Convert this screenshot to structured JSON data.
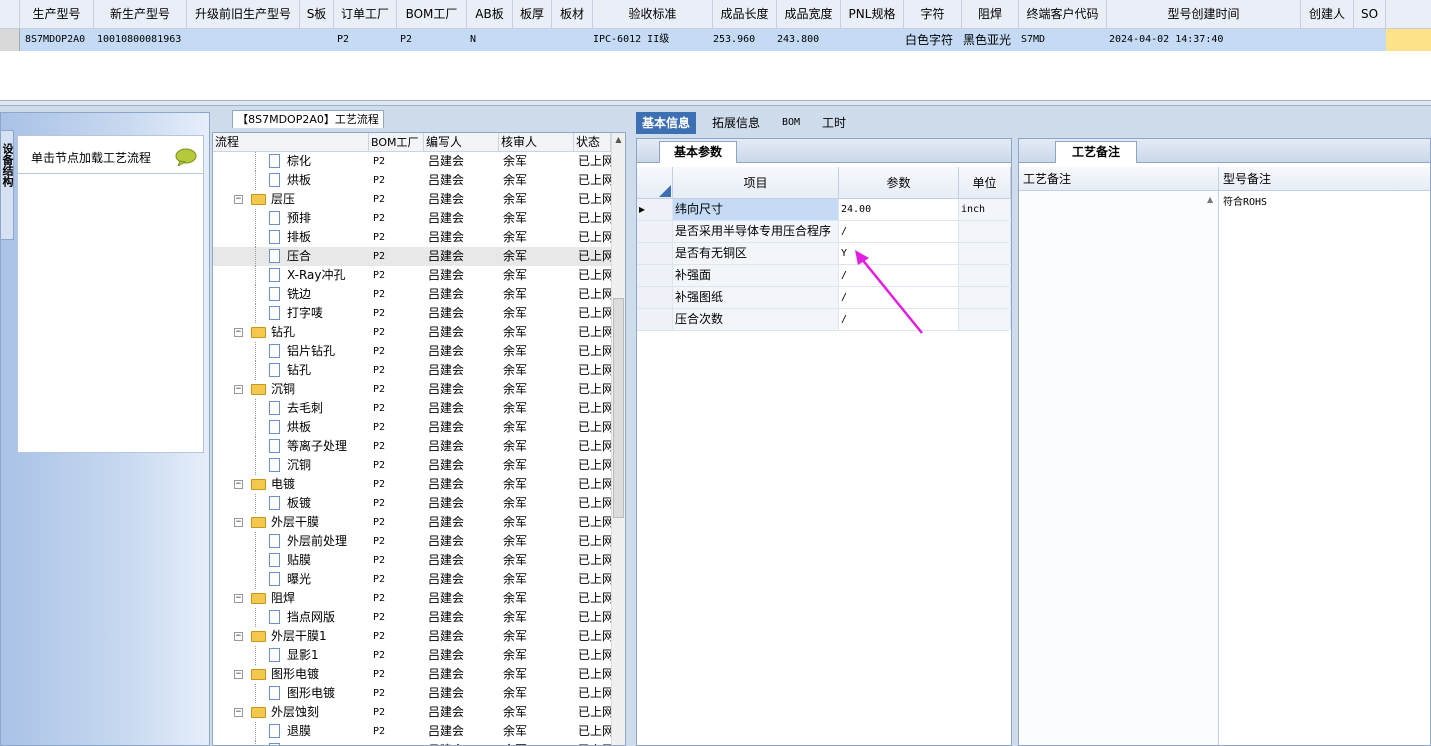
{
  "top_grid": {
    "headers": [
      "生产型号",
      "新生产型号",
      "升级前旧生产型号",
      "S板",
      "订单工厂",
      "BOM工厂",
      "AB板",
      "板厚",
      "板材",
      "验收标准",
      "成品长度",
      "成品宽度",
      "PNL规格",
      "字符",
      "阻焊",
      "终端客户代码",
      "型号创建时间",
      "创建人",
      "SO"
    ],
    "row": {
      "model": "8S7MDOP2A0",
      "new_model": "10010800081963",
      "order_factory": "P2",
      "bom_factory": "P2",
      "ab_board": "N",
      "standard": "IPC-6012 II级",
      "length": "253.960",
      "width": "243.800",
      "char": "白色字符",
      "mask": "黑色亚光",
      "customer": "S7MD",
      "created": "2024-04-02 14:37:40"
    }
  },
  "left_panel": {
    "vertical_tab": "设备结构",
    "hint": "单击节点加载工艺流程",
    "icon": "speech-bubble-icon"
  },
  "process": {
    "title": "【8S7MDOP2A0】工艺流程",
    "headers": [
      "流程",
      "BOM工厂",
      "编写人",
      "核审人",
      "状态"
    ],
    "rows": [
      {
        "name": "棕化",
        "level": 2,
        "folder": false,
        "bom": "P2",
        "writer": "吕建会",
        "reviewer": "余军",
        "status": "已上网"
      },
      {
        "name": "烘板",
        "level": 2,
        "folder": false,
        "bom": "P2",
        "writer": "吕建会",
        "reviewer": "余军",
        "status": "已上网"
      },
      {
        "name": "层压",
        "level": 1,
        "folder": true,
        "bom": "P2",
        "writer": "吕建会",
        "reviewer": "余军",
        "status": "已上网"
      },
      {
        "name": "预排",
        "level": 2,
        "folder": false,
        "bom": "P2",
        "writer": "吕建会",
        "reviewer": "余军",
        "status": "已上网"
      },
      {
        "name": "排板",
        "level": 2,
        "folder": false,
        "bom": "P2",
        "writer": "吕建会",
        "reviewer": "余军",
        "status": "已上网"
      },
      {
        "name": "压合",
        "level": 2,
        "folder": false,
        "bom": "P2",
        "writer": "吕建会",
        "reviewer": "余军",
        "status": "已上网",
        "selected": true
      },
      {
        "name": "X-Ray冲孔",
        "level": 2,
        "folder": false,
        "bom": "P2",
        "writer": "吕建会",
        "reviewer": "余军",
        "status": "已上网"
      },
      {
        "name": "铣边",
        "level": 2,
        "folder": false,
        "bom": "P2",
        "writer": "吕建会",
        "reviewer": "余军",
        "status": "已上网"
      },
      {
        "name": "打字唛",
        "level": 2,
        "folder": false,
        "bom": "P2",
        "writer": "吕建会",
        "reviewer": "余军",
        "status": "已上网"
      },
      {
        "name": "钻孔",
        "level": 1,
        "folder": true,
        "bom": "P2",
        "writer": "吕建会",
        "reviewer": "余军",
        "status": "已上网"
      },
      {
        "name": "铝片钻孔",
        "level": 2,
        "folder": false,
        "bom": "P2",
        "writer": "吕建会",
        "reviewer": "余军",
        "status": "已上网"
      },
      {
        "name": "钻孔",
        "level": 2,
        "folder": false,
        "bom": "P2",
        "writer": "吕建会",
        "reviewer": "余军",
        "status": "已上网"
      },
      {
        "name": "沉铜",
        "level": 1,
        "folder": true,
        "bom": "P2",
        "writer": "吕建会",
        "reviewer": "余军",
        "status": "已上网"
      },
      {
        "name": "去毛刺",
        "level": 2,
        "folder": false,
        "bom": "P2",
        "writer": "吕建会",
        "reviewer": "余军",
        "status": "已上网"
      },
      {
        "name": "烘板",
        "level": 2,
        "folder": false,
        "bom": "P2",
        "writer": "吕建会",
        "reviewer": "余军",
        "status": "已上网"
      },
      {
        "name": "等离子处理",
        "level": 2,
        "folder": false,
        "bom": "P2",
        "writer": "吕建会",
        "reviewer": "余军",
        "status": "已上网"
      },
      {
        "name": "沉铜",
        "level": 2,
        "folder": false,
        "bom": "P2",
        "writer": "吕建会",
        "reviewer": "余军",
        "status": "已上网"
      },
      {
        "name": "电镀",
        "level": 1,
        "folder": true,
        "bom": "P2",
        "writer": "吕建会",
        "reviewer": "余军",
        "status": "已上网"
      },
      {
        "name": "板镀",
        "level": 2,
        "folder": false,
        "bom": "P2",
        "writer": "吕建会",
        "reviewer": "余军",
        "status": "已上网"
      },
      {
        "name": "外层干膜",
        "level": 1,
        "folder": true,
        "bom": "P2",
        "writer": "吕建会",
        "reviewer": "余军",
        "status": "已上网"
      },
      {
        "name": "外层前处理",
        "level": 2,
        "folder": false,
        "bom": "P2",
        "writer": "吕建会",
        "reviewer": "余军",
        "status": "已上网"
      },
      {
        "name": "贴膜",
        "level": 2,
        "folder": false,
        "bom": "P2",
        "writer": "吕建会",
        "reviewer": "余军",
        "status": "已上网"
      },
      {
        "name": "曝光",
        "level": 2,
        "folder": false,
        "bom": "P2",
        "writer": "吕建会",
        "reviewer": "余军",
        "status": "已上网"
      },
      {
        "name": "阻焊",
        "level": 1,
        "folder": true,
        "bom": "P2",
        "writer": "吕建会",
        "reviewer": "余军",
        "status": "已上网"
      },
      {
        "name": "挡点网版",
        "level": 2,
        "folder": false,
        "bom": "P2",
        "writer": "吕建会",
        "reviewer": "余军",
        "status": "已上网"
      },
      {
        "name": "外层干膜1",
        "level": 1,
        "folder": true,
        "bom": "P2",
        "writer": "吕建会",
        "reviewer": "余军",
        "status": "已上网"
      },
      {
        "name": "显影1",
        "level": 2,
        "folder": false,
        "bom": "P2",
        "writer": "吕建会",
        "reviewer": "余军",
        "status": "已上网"
      },
      {
        "name": "图形电镀",
        "level": 1,
        "folder": true,
        "bom": "P2",
        "writer": "吕建会",
        "reviewer": "余军",
        "status": "已上网"
      },
      {
        "name": "图形电镀",
        "level": 2,
        "folder": false,
        "bom": "P2",
        "writer": "吕建会",
        "reviewer": "余军",
        "status": "已上网"
      },
      {
        "name": "外层蚀刻",
        "level": 1,
        "folder": true,
        "bom": "P2",
        "writer": "吕建会",
        "reviewer": "余军",
        "status": "已上网"
      },
      {
        "name": "退膜",
        "level": 2,
        "folder": false,
        "bom": "P2",
        "writer": "吕建会",
        "reviewer": "余军",
        "status": "已上网"
      },
      {
        "name": "",
        "level": 2,
        "folder": false,
        "bom": "P2",
        "writer": "吕建会",
        "reviewer": "余军",
        "status": "已上网"
      }
    ]
  },
  "tabs": [
    {
      "label": "基本信息",
      "active": true
    },
    {
      "label": "拓展信息",
      "active": false
    },
    {
      "label": "BOM",
      "active": false
    },
    {
      "label": "工时",
      "active": false
    }
  ],
  "basic_params": {
    "tab_label": "基本参数",
    "headers": [
      "项目",
      "参数",
      "单位"
    ],
    "rows": [
      {
        "item": "纬向尺寸",
        "value": "24.00",
        "unit": "inch",
        "current": true
      },
      {
        "item": "是否采用半导体专用压合程序",
        "value": "/",
        "unit": ""
      },
      {
        "item": "是否有无铜区",
        "value": "Y",
        "unit": ""
      },
      {
        "item": "补强面",
        "value": "/",
        "unit": ""
      },
      {
        "item": "补强图纸",
        "value": "/",
        "unit": ""
      },
      {
        "item": "压合次数",
        "value": "/",
        "unit": ""
      }
    ]
  },
  "notes": {
    "tab_label": "工艺备注",
    "headers": [
      "工艺备注",
      "型号备注"
    ],
    "model_note": "符合ROHS"
  },
  "colors": {
    "annotation_arrow": "#e21ce0",
    "active_tab": "#3d6fb3",
    "selected_row": "#c5dbf5"
  }
}
